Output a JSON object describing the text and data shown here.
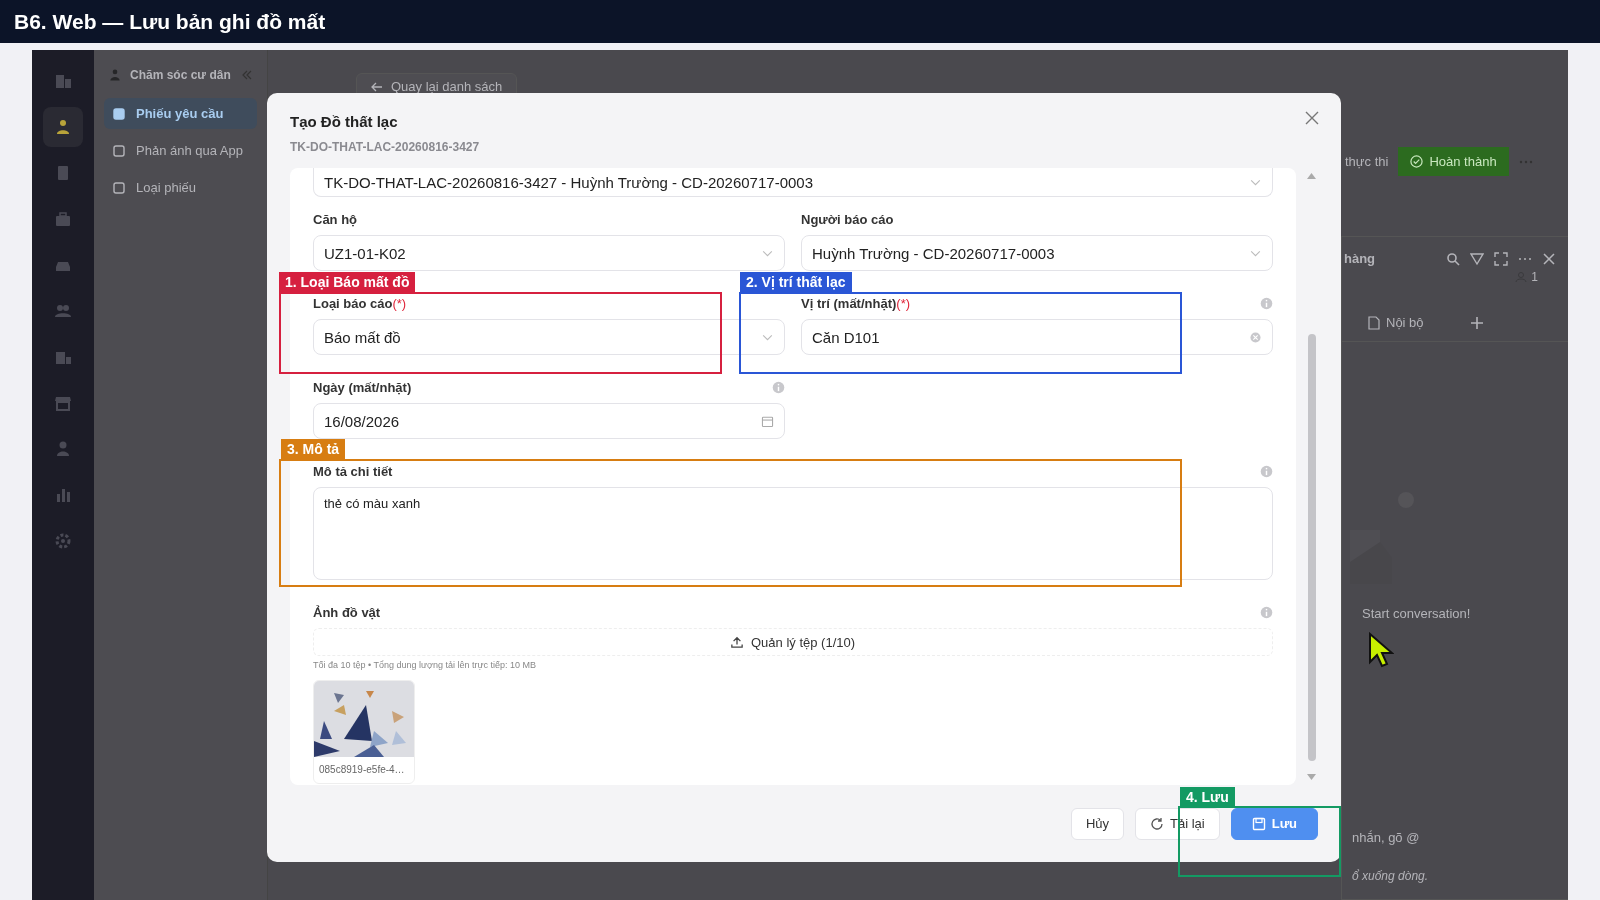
{
  "video_title": "B6. Web — Lưu bản ghi đồ mất",
  "nav_rail": [
    {
      "selected": false
    },
    {
      "selected": true
    },
    {
      "selected": false
    },
    {
      "selected": false
    },
    {
      "selected": false
    },
    {
      "selected": false
    },
    {
      "selected": false
    },
    {
      "selected": false
    },
    {
      "selected": false
    },
    {
      "selected": false
    },
    {
      "selected": false
    }
  ],
  "sidebar": {
    "title": "Chăm sóc cư dân",
    "items": [
      {
        "label": "Phiếu yêu cầu",
        "selected": true
      },
      {
        "label": "Phản ánh qua App",
        "selected": false
      },
      {
        "label": "Loại phiếu",
        "selected": false
      }
    ]
  },
  "back_button": "Quay lại danh sách",
  "status_text": "thực thi",
  "complete_button": "Hoàn thành",
  "chat_panel": {
    "title": "hàng",
    "member_count": "1",
    "tabs": [
      {
        "label": "Nội bộ"
      }
    ],
    "empty_text": "Start conversation!",
    "input_placeholder": "nhắn, gõ @",
    "input_hint": "ổ xuống dòng."
  },
  "modal": {
    "title": "Tạo Đồ thất lạc",
    "subtitle": "TK-DO-THAT-LAC-20260816-3427",
    "top_select": "TK-DO-THAT-LAC-20260816-3427 - Huỳnh Trường - CD-20260717-0003",
    "fields": [
      {
        "kind": "select",
        "label": "Căn hộ",
        "required": false,
        "info": false,
        "value": "UZ1-01-K02"
      },
      {
        "kind": "select",
        "label": "Người báo cáo",
        "required": false,
        "info": false,
        "value": "Huỳnh Trường - CD-20260717-0003"
      },
      {
        "kind": "select",
        "label": "Loại báo cáo",
        "required": true,
        "info": false,
        "value": "Báo mất đồ"
      },
      {
        "kind": "input",
        "label": "Vị trí (mất/nhặt)",
        "required": true,
        "info": true,
        "value": "Căn D101"
      },
      {
        "kind": "date",
        "label": "Ngày (mất/nhặt)",
        "required": false,
        "info": true,
        "value": "16/08/2026"
      },
      {
        "kind": "textarea",
        "label": "Mô tả chi tiết",
        "required": false,
        "info": true,
        "value": "thẻ có màu xanh"
      },
      {
        "kind": "upload",
        "label": "Ảnh đồ vật",
        "required": false,
        "info": true,
        "button": "Quản lý tệp (1/10)",
        "hint": "Tối đa 10 tệp • Tổng dung lượng tải lên trực tiếp: 10 MB",
        "files": [
          {
            "name": "085c8919-e5fe-4…",
            "kind": "picture"
          }
        ]
      }
    ],
    "required_mark": "(*)",
    "buttons": [
      {
        "label": "Hủy",
        "kind": "default"
      },
      {
        "label": "Tải lại",
        "kind": "reload"
      },
      {
        "label": "Lưu",
        "kind": "primary"
      }
    ]
  },
  "callouts": [
    {
      "label": "1. Loại Báo mất đồ",
      "color": "#d6203f"
    },
    {
      "label": "2. Vị trí thất lạc",
      "color": "#2a56d6"
    },
    {
      "label": "3. Mô tả",
      "color": "#d77d12"
    },
    {
      "label": "4. Lưu",
      "color": "#139a63"
    }
  ]
}
